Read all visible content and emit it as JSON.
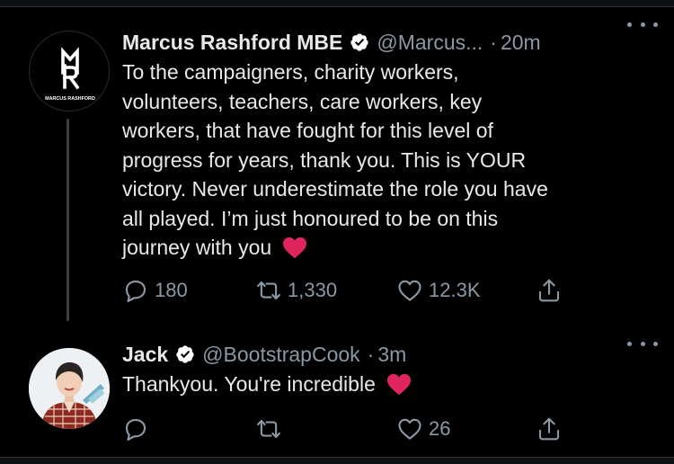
{
  "tweets": [
    {
      "display_name": "Marcus Rashford MBE",
      "handle": "@Marcus...",
      "time_separator": "·",
      "time": "20m",
      "verified": true,
      "avatar": {
        "logo_text": "MARCUS RASHFORD",
        "icon": "mr-logo"
      },
      "text": "To the campaigners, charity workers,\nvolunteers, teachers, care workers, key\nworkers, that have fought for this level of\nprogress for years, thank you. This is YOUR\nvictory. Never underestimate the role you have\nall played. I’m just honoured to be on this\njourney with you",
      "emoji": "red-heart",
      "reply_count": "180",
      "retweet_count": "1,330",
      "like_count": "12.3K"
    },
    {
      "display_name": "Jack",
      "handle": "@BootstrapCook",
      "time_separator": "·",
      "time": "3m",
      "verified": true,
      "avatar": {
        "icon": "profile-photo"
      },
      "text": "Thankyou. You're incredible",
      "emoji": "red-heart",
      "reply_count": "",
      "retweet_count": "",
      "like_count": "26"
    }
  ],
  "colors": {
    "background": "#000000",
    "text": "#e7e9ea",
    "muted": "#8b98a5",
    "heart": "#e0245e",
    "verified": "#ffffff"
  }
}
